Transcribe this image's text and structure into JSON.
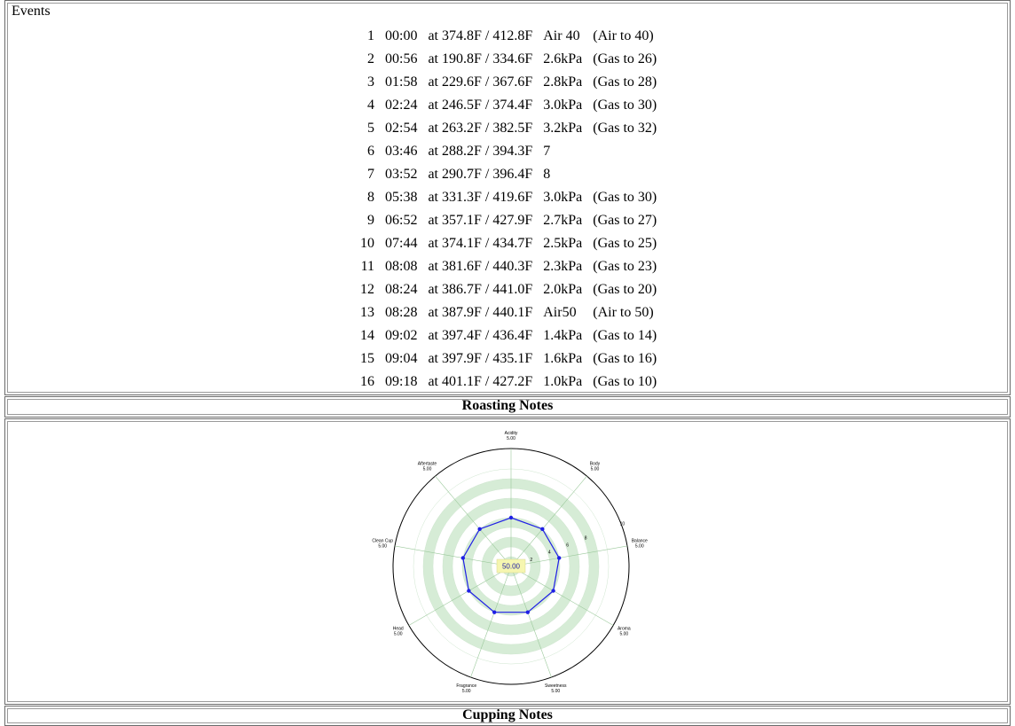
{
  "events": {
    "title": "Events",
    "rows": [
      {
        "n": "1",
        "time": "00:00",
        "temps": "at 374.8F / 412.8F",
        "val": "Air 40",
        "note": "(Air to 40)"
      },
      {
        "n": "2",
        "time": "00:56",
        "temps": "at 190.8F / 334.6F",
        "val": "2.6kPa",
        "note": "(Gas to 26)"
      },
      {
        "n": "3",
        "time": "01:58",
        "temps": "at 229.6F / 367.6F",
        "val": "2.8kPa",
        "note": "(Gas to 28)"
      },
      {
        "n": "4",
        "time": "02:24",
        "temps": "at 246.5F / 374.4F",
        "val": "3.0kPa",
        "note": "(Gas to 30)"
      },
      {
        "n": "5",
        "time": "02:54",
        "temps": "at 263.2F / 382.5F",
        "val": "3.2kPa",
        "note": "(Gas to 32)"
      },
      {
        "n": "6",
        "time": "03:46",
        "temps": "at 288.2F / 394.3F",
        "val": "7",
        "note": ""
      },
      {
        "n": "7",
        "time": "03:52",
        "temps": "at 290.7F / 396.4F",
        "val": "8",
        "note": ""
      },
      {
        "n": "8",
        "time": "05:38",
        "temps": "at 331.3F / 419.6F",
        "val": "3.0kPa",
        "note": "(Gas to 30)"
      },
      {
        "n": "9",
        "time": "06:52",
        "temps": "at 357.1F / 427.9F",
        "val": "2.7kPa",
        "note": "(Gas to 27)"
      },
      {
        "n": "10",
        "time": "07:44",
        "temps": "at 374.1F / 434.7F",
        "val": "2.5kPa",
        "note": "(Gas to 25)"
      },
      {
        "n": "11",
        "time": "08:08",
        "temps": "at 381.6F / 440.3F",
        "val": "2.3kPa",
        "note": "(Gas to 23)"
      },
      {
        "n": "12",
        "time": "08:24",
        "temps": "at 386.7F / 441.0F",
        "val": "2.0kPa",
        "note": "(Gas to 20)"
      },
      {
        "n": "13",
        "time": "08:28",
        "temps": "at 387.9F / 440.1F",
        "val": "Air50",
        "note": "(Air to 50)"
      },
      {
        "n": "14",
        "time": "09:02",
        "temps": "at 397.4F / 436.4F",
        "val": "1.4kPa",
        "note": "(Gas to 14)"
      },
      {
        "n": "15",
        "time": "09:04",
        "temps": "at 397.9F / 435.1F",
        "val": "1.6kPa",
        "note": "(Gas to 16)"
      },
      {
        "n": "16",
        "time": "09:18",
        "temps": "at 401.1F / 427.2F",
        "val": "1.0kPa",
        "note": "(Gas to 10)"
      }
    ]
  },
  "roasting_notes": {
    "heading": "Roasting Notes"
  },
  "cupping_notes": {
    "heading": "Cupping Notes"
  },
  "chart_data": {
    "type": "radar",
    "total": "50.00",
    "rmax": 10,
    "ticks": [
      "2",
      "4",
      "6",
      "8",
      "10"
    ],
    "axes": [
      {
        "name": "Acidity",
        "value": 5,
        "label": "5.00"
      },
      {
        "name": "Body",
        "value": 5,
        "label": "5.00"
      },
      {
        "name": "Balance",
        "value": 5,
        "label": "5.00"
      },
      {
        "name": "Aroma",
        "value": 5,
        "label": "5.00"
      },
      {
        "name": "Sweetness",
        "value": 5,
        "label": "5.00"
      },
      {
        "name": "Fragrance",
        "value": 5,
        "label": "5.00"
      },
      {
        "name": "Head",
        "value": 5,
        "label": "5.00"
      },
      {
        "name": "Clean Cup",
        "value": 5,
        "label": "5.00"
      },
      {
        "name": "Aftertaste",
        "value": 5,
        "label": "5.00"
      }
    ],
    "colors": {
      "series": "#1f1fe6",
      "band": "#d6ecd6",
      "spoke": "#9cc99c",
      "total_bg": "#f6f6b0"
    }
  }
}
